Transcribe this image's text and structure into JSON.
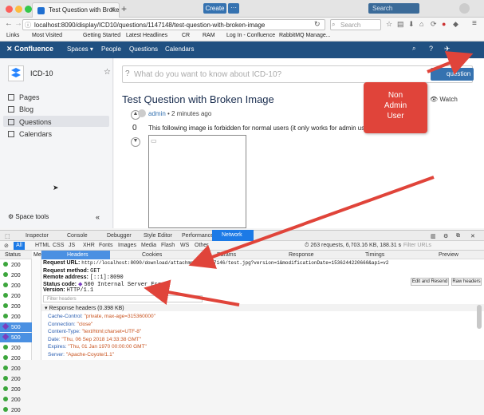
{
  "browser": {
    "tab_title": "Test Question with Broken ...",
    "url": "localhost:8090/display/ICD10/questions/1147148/test-question-with-broken-image",
    "search_placeholder": "Search",
    "bookmarks": [
      "Links",
      "Most Visited",
      "Getting Started",
      "Latest Headlines",
      "CR",
      "RAM",
      "Log In - Confluence",
      "RabbitMQ Manage..."
    ]
  },
  "confluence": {
    "logo": "Confluence",
    "nav": [
      "Spaces",
      "People",
      "Questions",
      "Calendars"
    ],
    "create_label": "Create",
    "more_label": "···",
    "search_placeholder": "Search"
  },
  "sidebar": {
    "space_name": "ICD-10",
    "items": [
      {
        "label": "Pages"
      },
      {
        "label": "Blog"
      },
      {
        "label": "Questions"
      },
      {
        "label": "Calendars"
      }
    ],
    "space_tools": "Space tools",
    "collapse": "«"
  },
  "main": {
    "ask_placeholder": "What do you want to know about ICD-10?",
    "ask_button": "question",
    "question_title": "Test Question with Broken Image",
    "author": "admin",
    "time_ago": "2 minutes ago",
    "vote_count": "0",
    "body": "This following image is forbidden for normal users (it only works for admin user)",
    "watch": "Watch"
  },
  "callout": {
    "lines": [
      "Non",
      "Admin",
      "User"
    ],
    "color": "#e0443a"
  },
  "devtools": {
    "tabs": [
      "Inspector",
      "Console",
      "Debugger",
      "Style Editor",
      "Performance",
      "Network"
    ],
    "filters": [
      "All",
      "HTML",
      "CSS",
      "JS",
      "XHR",
      "Fonts",
      "Images",
      "Media",
      "Flash",
      "WS",
      "Other"
    ],
    "stats": "263 requests, 6,703.16 KB, 188.31 s",
    "filter_urls": "Filter URLs",
    "status_header": "Status",
    "status_rows": [
      "200",
      "200",
      "200",
      "200",
      "200",
      "200",
      "500",
      "500",
      "200",
      "200",
      "200",
      "200",
      "200",
      "200",
      "200"
    ],
    "subtabs": [
      "Headers",
      "Cookies",
      "Params",
      "Response",
      "Timings",
      "Preview"
    ],
    "request_url_label": "Request URL:",
    "request_url": "http://localhost:8090/download/attachments/1147146/test.jpg?version=1&modificationDate=1536244220660&api=v2",
    "request_method_label": "Request method:",
    "request_method": "GET",
    "remote_address_label": "Remote address:",
    "remote_address": "[::1]:8090",
    "status_code_label": "Status code:",
    "status_code": "500 Internal Server Error",
    "version_label": "Version:",
    "version": "HTTP/1.1",
    "edit_resend": "Edit and Resend",
    "raw_headers": "Raw headers",
    "filter_headers": "Filter headers",
    "response_headers": "Response headers (0.398 KB)",
    "headers": [
      {
        "k": "Cache-Control:",
        "v": "\"private, max-age=315360000\""
      },
      {
        "k": "Connection:",
        "v": "\"close\""
      },
      {
        "k": "Content-Type:",
        "v": "\"text/html;charset=UTF-8\""
      },
      {
        "k": "Date:",
        "v": "\"Thu, 06 Sep 2018 14:33:38 GMT\""
      },
      {
        "k": "Expires:",
        "v": "\"Thu, 01 Jan 1970 00:00:00 GMT\""
      },
      {
        "k": "Server:",
        "v": "\"Apache-Coyote/1.1\""
      }
    ]
  }
}
